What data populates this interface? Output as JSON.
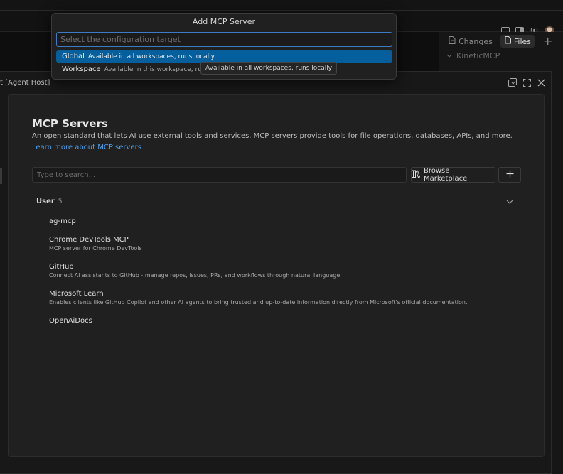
{
  "quick_pick": {
    "title": "Add MCP Server",
    "placeholder": "Select the configuration target",
    "items": [
      {
        "label": "Global",
        "description": "Available in all workspaces, runs locally"
      },
      {
        "label": "Workspace",
        "description": "Available in this workspace, runs lo"
      }
    ],
    "tooltip": "Available in all workspaces, runs locally"
  },
  "right_panel": {
    "tabs": [
      {
        "label": "Changes",
        "icon": "file-diff-icon"
      },
      {
        "label": "Files",
        "icon": "files-icon"
      }
    ],
    "tree_root": "KineticMCP"
  },
  "editor": {
    "title_fragment": "t [Agent Host]"
  },
  "mcp": {
    "title": "MCP Servers",
    "description": "An open standard that lets AI use external tools and services. MCP servers provide tools for file operations, databases, APIs, and more.",
    "learn_more": "Learn more about MCP servers",
    "search_placeholder": "Type to search...",
    "browse_label": "Browse Marketplace",
    "group": {
      "label": "User",
      "count": "5"
    },
    "servers": [
      {
        "name": "ag-mcp",
        "description": ""
      },
      {
        "name": "Chrome DevTools MCP",
        "description": "MCP server for Chrome DevTools"
      },
      {
        "name": "GitHub",
        "description": "Connect AI assistants to GitHub - manage repos, issues, PRs, and workflows through natural language."
      },
      {
        "name": "Microsoft Learn",
        "description": "Enables clients like GitHub Copilot and other AI agents to bring trusted and up-to-date information directly from Microsoft's official documentation."
      },
      {
        "name": "OpenAiDocs",
        "description": ""
      }
    ]
  },
  "colors": {
    "accent": "#045f9c",
    "link": "#4aa3f0",
    "focus_border": "#3d7cc5"
  }
}
